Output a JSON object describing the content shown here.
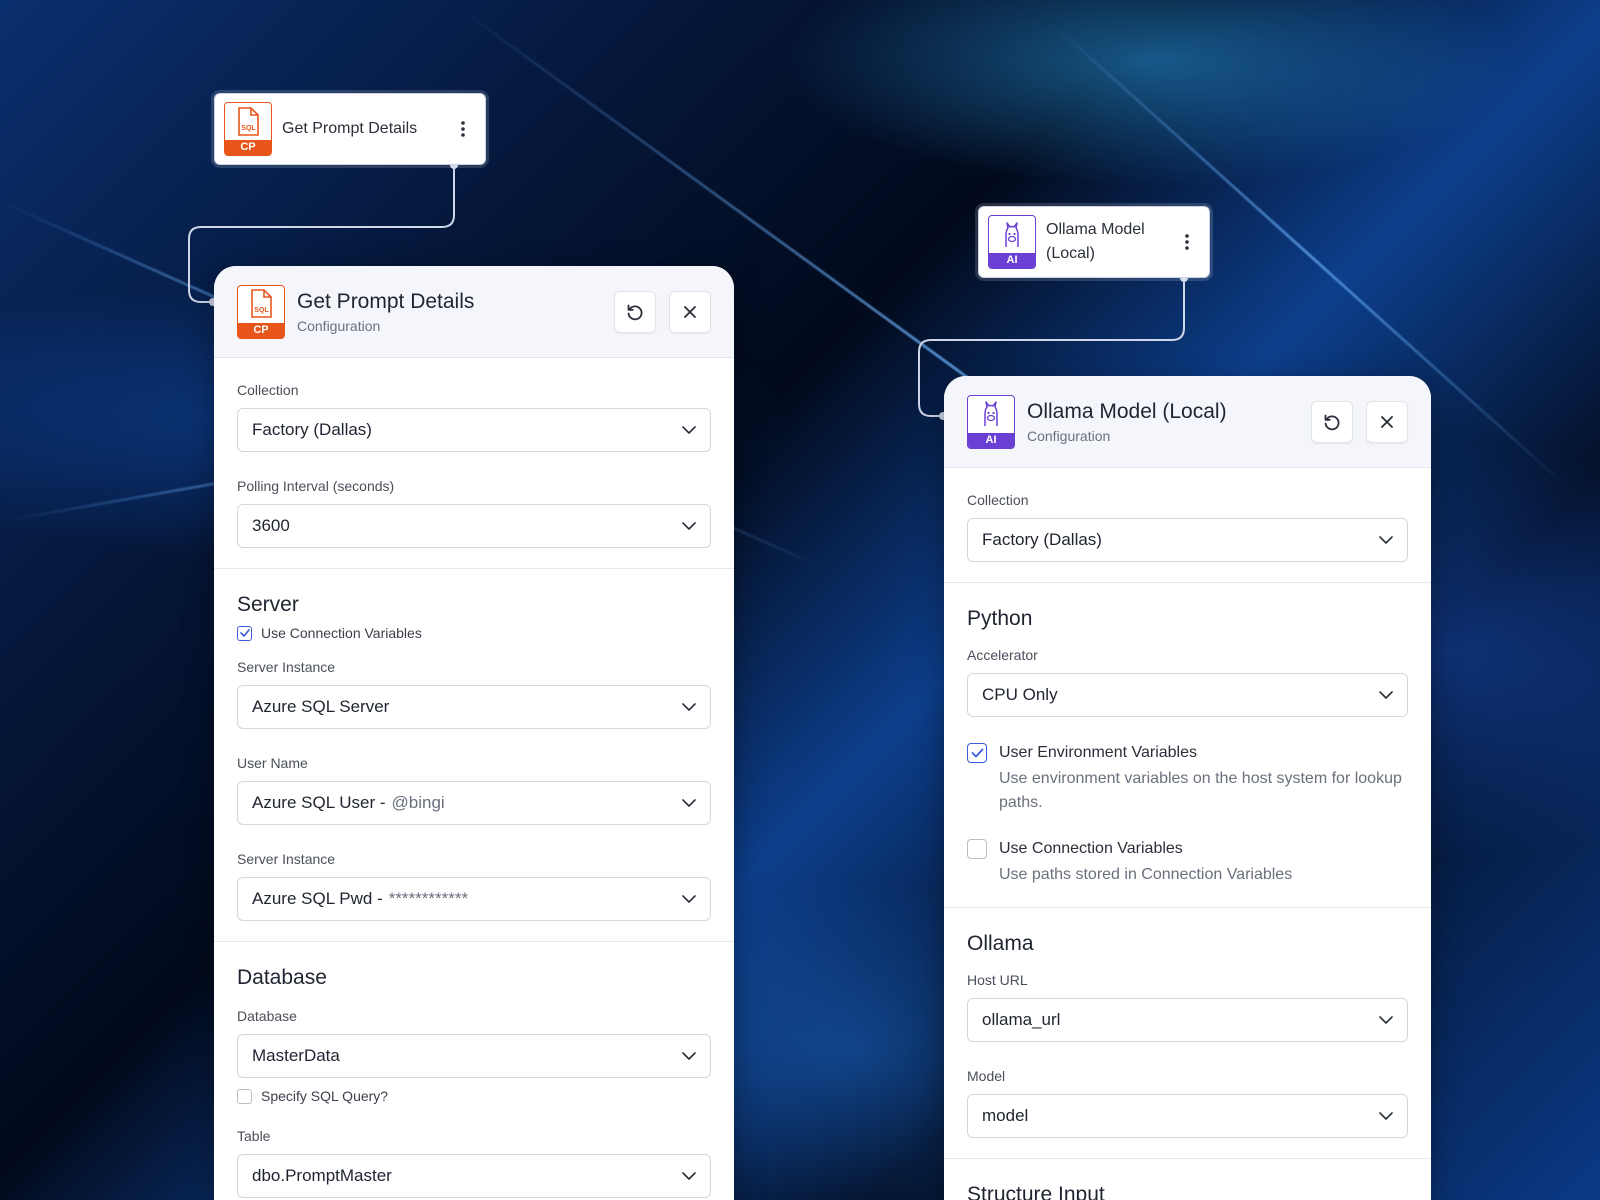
{
  "nodes": {
    "prompt": {
      "title": "Get Prompt Details",
      "badge": "CP",
      "badge_art": "SQL",
      "icon": "sql-file-icon"
    },
    "ollama": {
      "title_line1": "Ollama Model",
      "title_line2": "(Local)",
      "badge": "AI",
      "icon": "llama-icon"
    }
  },
  "left_panel": {
    "title": "Get Prompt Details",
    "subtitle": "Configuration",
    "badge": "CP",
    "badge_art": "SQL",
    "collection": {
      "label": "Collection",
      "value": "Factory (Dallas)"
    },
    "polling": {
      "label": "Polling Interval (seconds)",
      "value": "3600"
    },
    "server": {
      "title": "Server",
      "use_connection_variables": {
        "label": "Use Connection Variables",
        "checked": true
      },
      "instance": {
        "label": "Server Instance",
        "value": "Azure SQL Server"
      },
      "user": {
        "label": "User Name",
        "value": "Azure SQL User -",
        "suffix": "@bingi"
      },
      "password": {
        "label": "Server Instance",
        "value": "Azure SQL Pwd -",
        "suffix": "************"
      }
    },
    "database": {
      "title": "Database",
      "db": {
        "label": "Database",
        "value": "MasterData"
      },
      "specify_sql": {
        "label": "Specify SQL Query?",
        "checked": false
      },
      "table": {
        "label": "Table",
        "value": "dbo.PromptMaster"
      }
    }
  },
  "right_panel": {
    "title": "Ollama Model (Local)",
    "subtitle": "Configuration",
    "badge": "AI",
    "collection": {
      "label": "Collection",
      "value": "Factory (Dallas)"
    },
    "python": {
      "title": "Python",
      "accelerator": {
        "label": "Accelerator",
        "value": "CPU Only"
      },
      "env_vars": {
        "label": "User Environment Variables",
        "desc": "Use environment variables on the host system for lookup paths.",
        "checked": true
      },
      "conn_vars": {
        "label": "Use Connection Variables",
        "desc": "Use paths stored in Connection Variables",
        "checked": false
      }
    },
    "ollama": {
      "title": "Ollama",
      "host": {
        "label": "Host URL",
        "value": "ollama_url"
      },
      "model": {
        "label": "Model",
        "value": "model"
      }
    },
    "next_section_title": "Structure Input"
  },
  "colors": {
    "accent": "#3b5bdb",
    "sql_orange": "#e8551b",
    "ai_purple": "#6a3fd3"
  }
}
